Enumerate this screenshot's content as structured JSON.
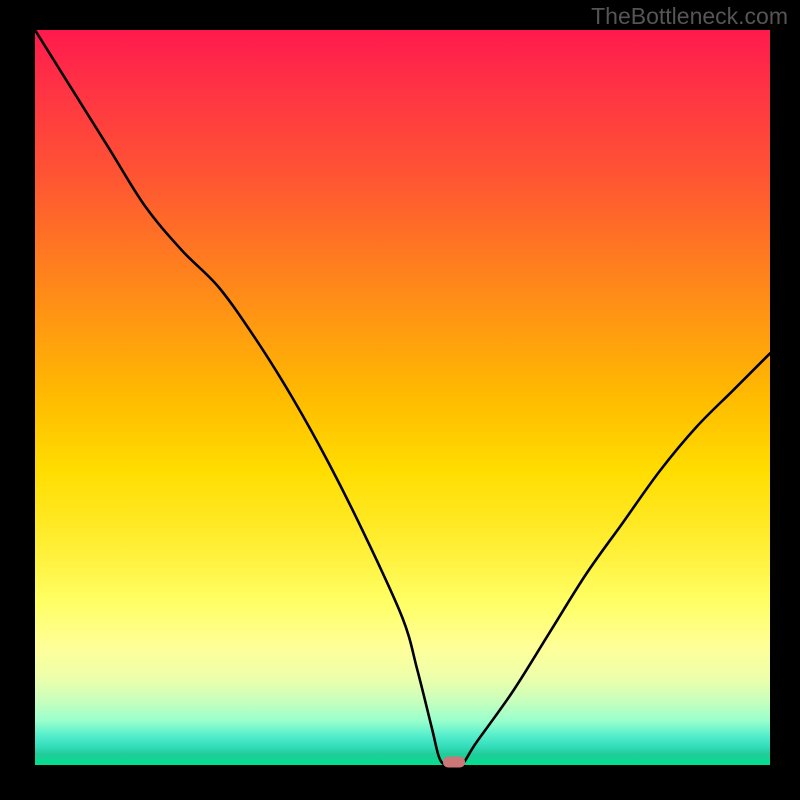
{
  "watermark": "TheBottleneck.com",
  "chart_data": {
    "type": "line",
    "title": "",
    "xlabel": "",
    "ylabel": "",
    "xlim": [
      0,
      100
    ],
    "ylim": [
      0,
      100
    ],
    "x": [
      0,
      5,
      10,
      15,
      20,
      25,
      30,
      35,
      40,
      45,
      50,
      52,
      54,
      55,
      56,
      58,
      60,
      65,
      70,
      75,
      80,
      85,
      90,
      95,
      100
    ],
    "values": [
      100,
      92,
      84,
      76,
      70,
      65,
      58,
      50,
      41,
      31,
      20,
      13,
      5,
      1,
      0,
      0,
      3,
      10,
      18,
      26,
      33,
      40,
      46,
      51,
      56
    ],
    "marker": {
      "x": 57,
      "y": 0
    },
    "gradient_bands": [
      {
        "color": "#ff1a4d",
        "stop": 0
      },
      {
        "color": "#ff9911",
        "stop": 40
      },
      {
        "color": "#ffee33",
        "stop": 70
      },
      {
        "color": "#00e090",
        "stop": 100
      }
    ]
  }
}
